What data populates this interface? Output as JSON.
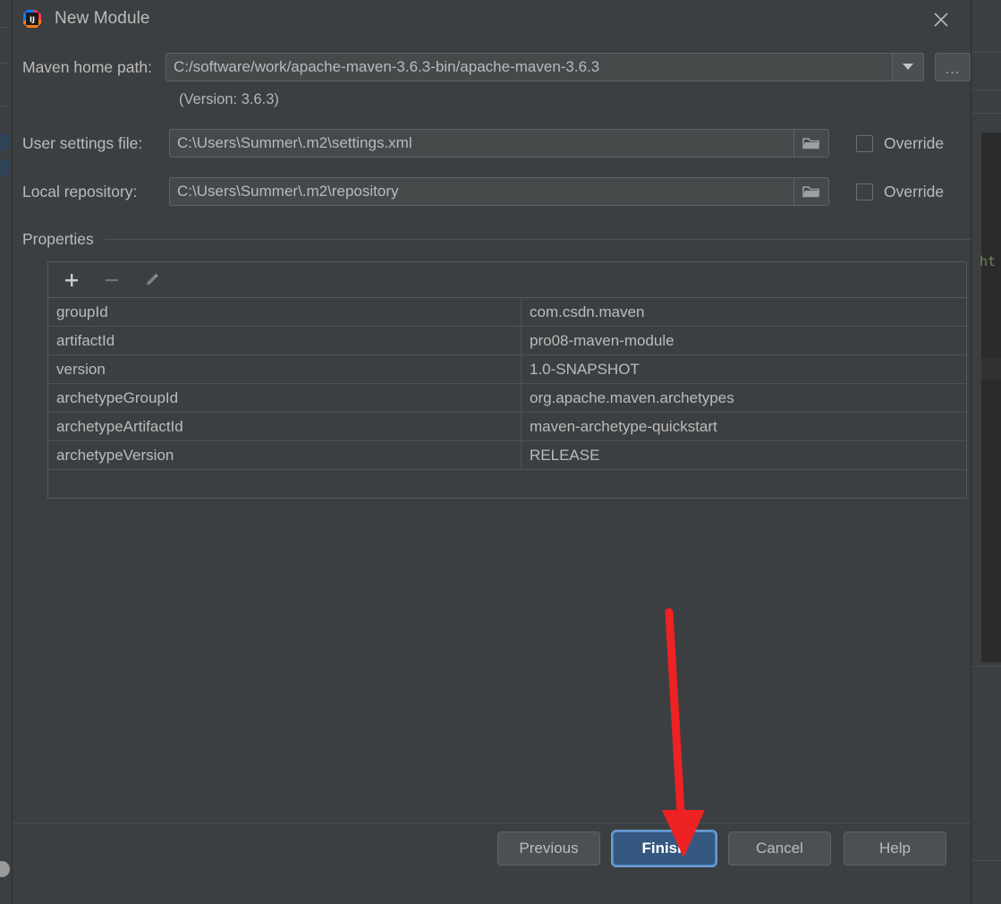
{
  "dialog": {
    "title": "New Module",
    "logo_icon": "intellij-idea-logo",
    "close_icon": "close-icon"
  },
  "form": {
    "maven_home": {
      "label": "Maven home path:",
      "value": "C:/software/work/apache-maven-3.6.3-bin/apache-maven-3.6.3",
      "dropdown_icon": "chevron-down-icon",
      "browse_label": "...",
      "version_note": "(Version: 3.6.3)"
    },
    "user_settings": {
      "label": "User settings file:",
      "value": "C:\\Users\\Summer\\.m2\\settings.xml",
      "folder_icon": "folder-icon",
      "override_label": "Override",
      "override_checked": false
    },
    "local_repository": {
      "label": "Local repository:",
      "value": "C:\\Users\\Summer\\.m2\\repository",
      "folder_icon": "folder-icon",
      "override_label": "Override",
      "override_checked": false
    }
  },
  "properties": {
    "section_title": "Properties",
    "toolbar": {
      "add_icon": "plus-icon",
      "remove_icon": "minus-icon",
      "edit_icon": "pencil-icon"
    },
    "rows": [
      {
        "key": "groupId",
        "value": "com.csdn.maven"
      },
      {
        "key": "artifactId",
        "value": "pro08-maven-module"
      },
      {
        "key": "version",
        "value": "1.0-SNAPSHOT"
      },
      {
        "key": "archetypeGroupId",
        "value": "org.apache.maven.archetypes"
      },
      {
        "key": "archetypeArtifactId",
        "value": "maven-archetype-quickstart"
      },
      {
        "key": "archetypeVersion",
        "value": "RELEASE"
      }
    ]
  },
  "footer": {
    "previous_label": "Previous",
    "finish_label": "Finish",
    "cancel_label": "Cancel",
    "help_label": "Help"
  },
  "annotation": {
    "arrow_color": "#ee2222",
    "points_to": "Finish"
  },
  "background": {
    "code_fragment": "ht"
  },
  "colors": {
    "dialog_bg": "#3c3f41",
    "field_bg": "#45494a",
    "text": "#bbbbbb",
    "primary_button": "#365880",
    "editor_bg": "#2b2b2b",
    "code_green": "#6a8759"
  }
}
